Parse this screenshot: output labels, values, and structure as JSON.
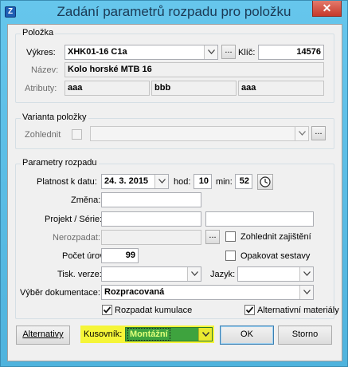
{
  "window": {
    "title": "Zadání parametrů rozpadu pro položku",
    "close_label": "✕",
    "icon_letter": "Z"
  },
  "polozka": {
    "legend": "Položka",
    "vykres_label": "Výkres:",
    "vykres_value": "XHK01-16 C1a",
    "klic_label": "Klíč:",
    "klic_value": "14576",
    "nazev_label": "Název:",
    "nazev_value": "Kolo horské MTB 16",
    "atributy_label": "Atributy:",
    "atributy": [
      "aaa",
      "bbb",
      "aaa"
    ]
  },
  "varianta": {
    "legend": "Varianta položky",
    "zohlednit_label": "Zohlednit",
    "combo_value": ""
  },
  "parametry": {
    "legend": "Parametry rozpadu",
    "platnost_label": "Platnost k datu:",
    "platnost_value": "24. 3. 2015",
    "hod_label": "hod:",
    "hod_value": "10",
    "min_label": "min:",
    "min_value": "52",
    "zmena_label": "Změna:",
    "zmena_value": "",
    "projekt_label": "Projekt / Série:",
    "projekt_value": "",
    "serie_value": "",
    "nerozpadat_label": "Nerozpadat:",
    "nerozpadat_value": "",
    "zohlednit_zajisteni_label": "Zohlednit zajištění",
    "pocet_urovni_label": "Počet úrovní:",
    "pocet_urovni_value": "99",
    "opakovat_sestavy_label": "Opakovat sestavy",
    "tisk_verze_label": "Tisk. verze:",
    "tisk_verze_value": "",
    "jazyk_label": "Jazyk:",
    "jazyk_value": "",
    "vyber_dokumentace_label": "Výběr dokumentace:",
    "vyber_dokumentace_value": "Rozpracovaná",
    "rozpadat_kumulace_label": "Rozpadat kumulace",
    "alternativni_materialy_label": "Alternativní materiály"
  },
  "footer": {
    "alternativy_label": "Alternativy",
    "kusovnik_label": "Kusovník:",
    "kusovnik_value": "Montážní",
    "ok_label": "OK",
    "storno_label": "Storno"
  },
  "ellipsis": "..."
}
